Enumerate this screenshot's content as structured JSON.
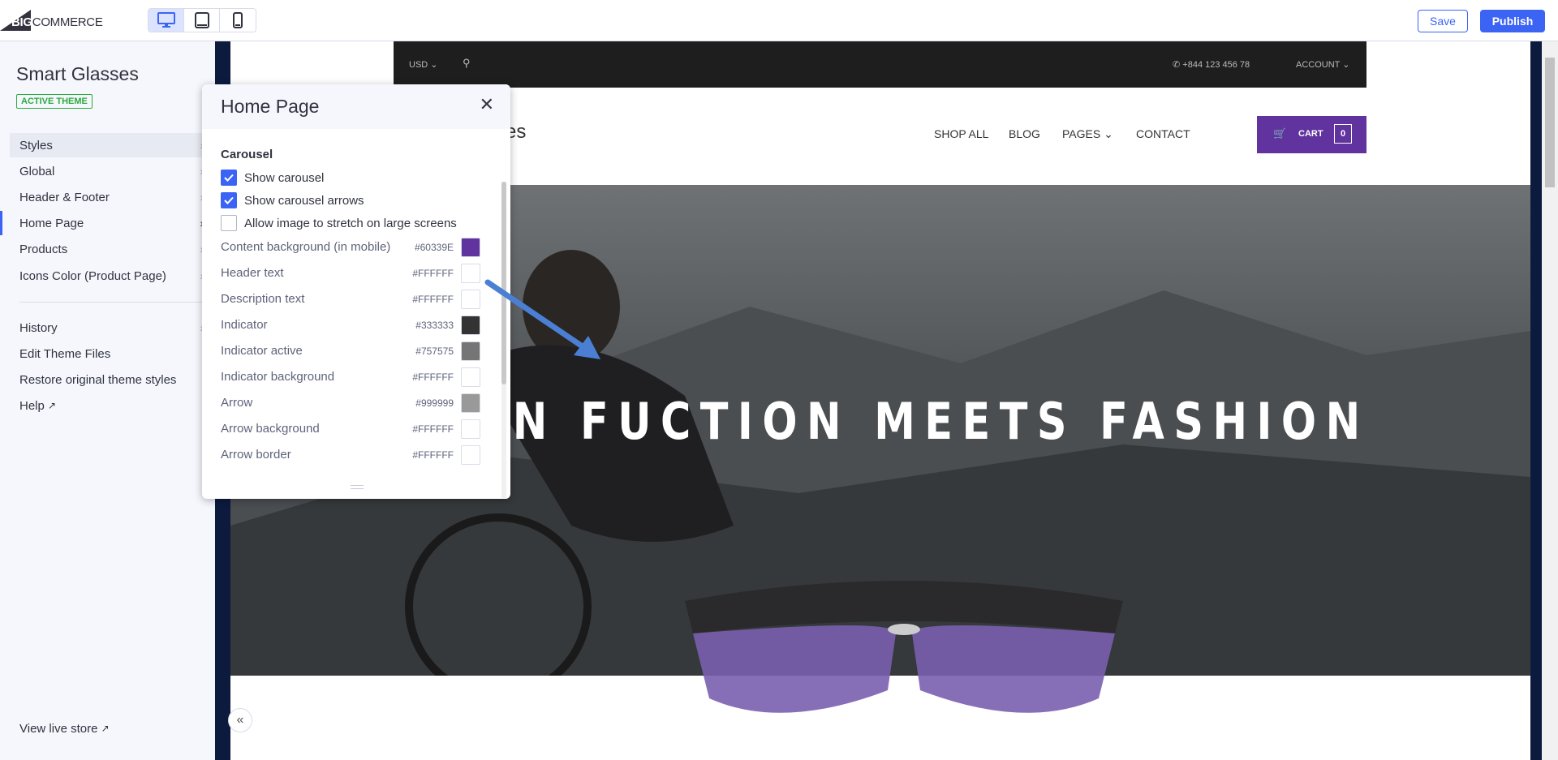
{
  "app": {
    "logo": "BIGCOMMERCE",
    "logo_bold": "BIG",
    "logo_rest": "COMMERCE",
    "save": "Save",
    "publish": "Publish",
    "devices": [
      "desktop-icon",
      "tablet-icon",
      "mobile-icon"
    ],
    "accent": "#3C64F4"
  },
  "sidebar": {
    "title": "Smart Glasses",
    "badge": "ACTIVE THEME",
    "items": [
      {
        "label": "Styles"
      },
      {
        "label": "Global"
      },
      {
        "label": "Header & Footer"
      },
      {
        "label": "Home Page"
      },
      {
        "label": "Products"
      },
      {
        "label": "Icons Color (Product Page)"
      }
    ],
    "links": [
      {
        "label": "History"
      },
      {
        "label": "Edit Theme Files"
      },
      {
        "label": "Restore original theme styles"
      },
      {
        "label": "Help"
      }
    ],
    "view_live": "View live store",
    "collapse": "«"
  },
  "store": {
    "currency": "USD",
    "phone": "+844 123 456 78",
    "account": "ACCOUNT",
    "logo_partial": "es",
    "nav": [
      "SHOP ALL",
      "BLOG",
      "PAGES",
      "CONTACT"
    ],
    "cart_label": "CART",
    "cart_count": "0",
    "cart_color": "#60339E",
    "hero_text": "WHEN FUCTION MEETS FASHION"
  },
  "panel": {
    "title": "Home Page",
    "section": "Carousel",
    "checkboxes": [
      {
        "label": "Show carousel",
        "checked": true
      },
      {
        "label": "Show carousel arrows",
        "checked": true
      },
      {
        "label": "Allow image to stretch on large screens",
        "checked": false
      }
    ],
    "colors": [
      {
        "label": "Content background (in mobile)",
        "hex": "#60339E"
      },
      {
        "label": "Header text",
        "hex": "#FFFFFF"
      },
      {
        "label": "Description text",
        "hex": "#FFFFFF"
      },
      {
        "label": "Indicator",
        "hex": "#333333"
      },
      {
        "label": "Indicator active",
        "hex": "#757575"
      },
      {
        "label": "Indicator background",
        "hex": "#FFFFFF"
      },
      {
        "label": "Arrow",
        "hex": "#999999"
      },
      {
        "label": "Arrow background",
        "hex": "#FFFFFF"
      },
      {
        "label": "Arrow border",
        "hex": "#FFFFFF"
      }
    ]
  }
}
